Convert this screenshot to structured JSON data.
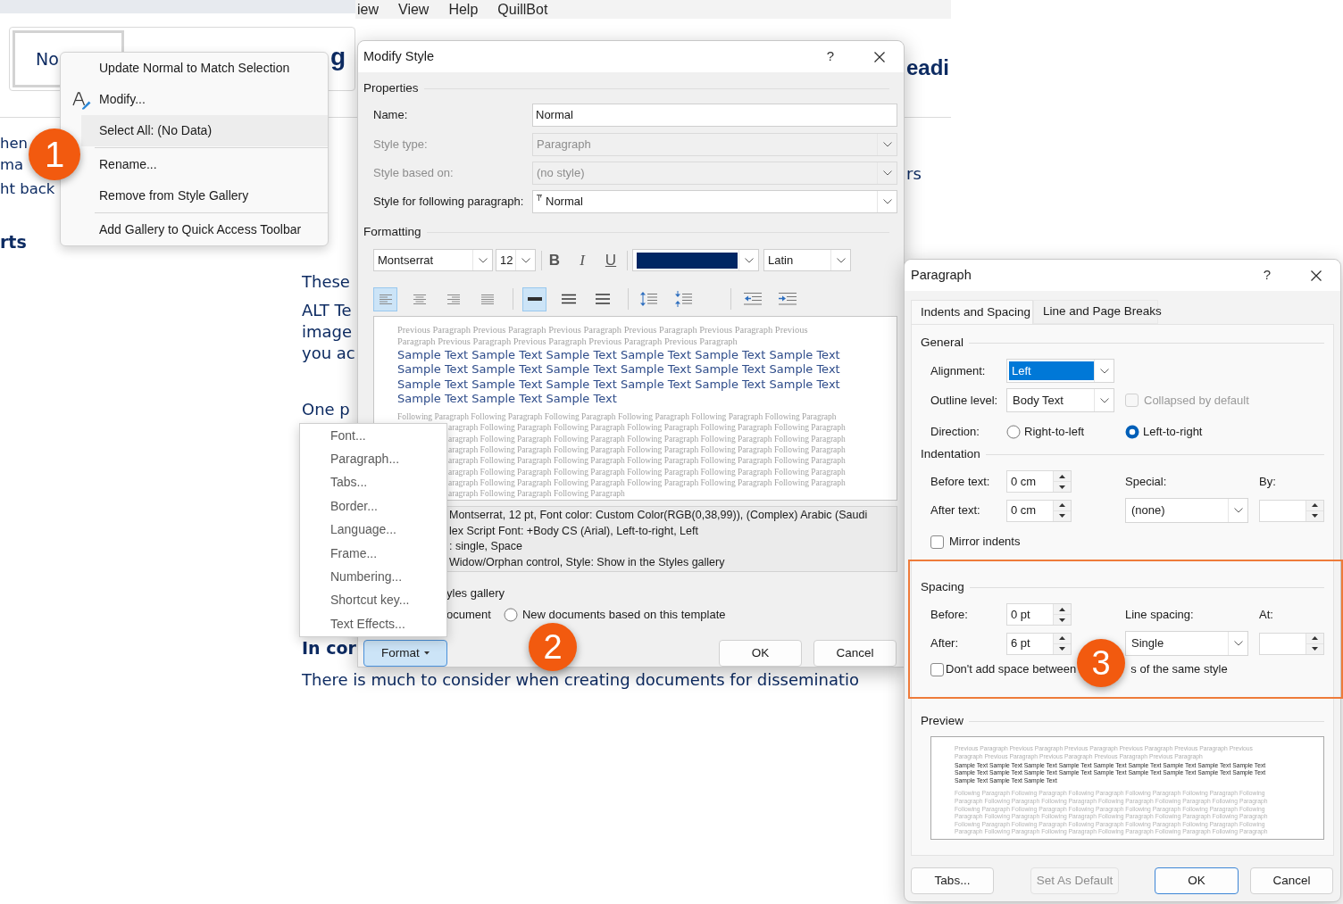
{
  "document": {
    "menu_bar": [
      "iew",
      "View",
      "Help",
      "QuillBot"
    ],
    "gallery_items": [
      {
        "text": "No",
        "kind": "normal",
        "selected": true
      },
      {
        "text": "g",
        "kind": "heading",
        "selected": false
      }
    ],
    "ribbon_right_item": "eadi",
    "left_lines": [
      {
        "text": "hen",
        "kind": "body"
      },
      {
        "text": "ma",
        "kind": "body"
      },
      {
        "text": "ht back",
        "kind": "body"
      },
      {
        "text": "rts",
        "kind": "heading"
      }
    ],
    "right_lines": [
      {
        "text": "rs",
        "kind": "body"
      }
    ],
    "center_lines": [
      {
        "text": "These",
        "kind": "body"
      },
      {
        "text": "ALT Te",
        "kind": "body"
      },
      {
        "text": "image",
        "kind": "body"
      },
      {
        "text": "you ac",
        "kind": "body"
      },
      {
        "text": "One p",
        "kind": "body"
      },
      {
        "text": "In cor",
        "kind": "heading"
      },
      {
        "text": "There is much to consider when creating documents for disseminatio",
        "kind": "body"
      }
    ]
  },
  "context_menu": {
    "items": [
      {
        "label": "Update Normal to Match Selection",
        "has_icon": false,
        "hovered": false,
        "separator_before": false
      },
      {
        "label": "Modify...",
        "has_icon": true,
        "hovered": false,
        "separator_before": false
      },
      {
        "label": "Select All: (No Data)",
        "has_icon": false,
        "hovered": true,
        "separator_before": false
      },
      {
        "label": "Rename...",
        "has_icon": false,
        "hovered": false,
        "separator_before": true
      },
      {
        "label": "Remove from Style Gallery",
        "has_icon": false,
        "hovered": false,
        "separator_before": false
      },
      {
        "label": "Add Gallery to Quick Access Toolbar",
        "has_icon": false,
        "hovered": false,
        "separator_before": true
      }
    ]
  },
  "modify_style": {
    "title": "Modify Style",
    "help": "?",
    "properties_heading": "Properties",
    "fields": [
      {
        "label": "Name:",
        "kind": "text",
        "value": "Normal",
        "disabled": false,
        "style_icon": false
      },
      {
        "label": "Style type:",
        "kind": "dropdown",
        "value": "Paragraph",
        "disabled": true,
        "style_icon": false
      },
      {
        "label": "Style based on:",
        "kind": "dropdown",
        "value": "(no style)",
        "disabled": true,
        "style_icon": false
      },
      {
        "label": "Style for following paragraph:",
        "kind": "dropdown",
        "value": "Normal",
        "disabled": false,
        "style_icon": true
      }
    ],
    "formatting_heading": "Formatting",
    "font": "Montserrat",
    "size": "12",
    "text_style_buttons": [
      {
        "label": "B",
        "kind": "bold"
      },
      {
        "label": "I",
        "kind": "italic"
      },
      {
        "label": "U",
        "kind": "underline"
      }
    ],
    "font_color": {
      "color": "#002663"
    },
    "script": "Latin",
    "alignment_buttons": [
      {
        "kind": "left",
        "selected": true
      },
      {
        "kind": "center",
        "selected": false
      },
      {
        "kind": "right",
        "selected": false
      },
      {
        "kind": "justify",
        "selected": false
      }
    ],
    "line_spacing_buttons": [
      {
        "kind": "single",
        "selected": true
      },
      {
        "kind": "one_half",
        "selected": false
      },
      {
        "kind": "double",
        "selected": false
      }
    ],
    "paragraph_spacing_buttons": [
      {
        "kind": "increase"
      },
      {
        "kind": "decrease"
      }
    ],
    "indent_buttons": [
      {
        "kind": "decrease"
      },
      {
        "kind": "increase"
      }
    ],
    "preview": {
      "previous": "Previous Paragraph Previous Paragraph Previous Paragraph Previous Paragraph Previous Paragraph Previous Paragraph Previous Paragraph Previous Paragraph Previous Paragraph Previous Paragraph",
      "sample": "Sample Text Sample Text Sample Text Sample Text Sample Text Sample Text Sample Text Sample Text Sample Text Sample Text Sample Text Sample Text Sample Text Sample Text Sample Text Sample Text Sample Text Sample Text Sample Text Sample Text Sample Text",
      "following": [
        "Following Paragraph Following Paragraph Following Paragraph Following Paragraph Following Paragraph Following Paragraph",
        "aragraph Following Paragraph Following Paragraph Following Paragraph Following Paragraph Following Paragraph",
        "aragraph Following Paragraph Following Paragraph Following Paragraph Following Paragraph Following Paragraph",
        "aragraph Following Paragraph Following Paragraph Following Paragraph Following Paragraph Following Paragraph",
        "aragraph Following Paragraph Following Paragraph Following Paragraph Following Paragraph Following Paragraph",
        "aragraph Following Paragraph Following Paragraph Following Paragraph Following Paragraph Following Paragraph",
        "aragraph Following Paragraph Following Paragraph Following Paragraph Following Paragraph Following Paragraph",
        "aragraph Following Paragraph Following Paragraph"
      ]
    },
    "description": [
      "Montserrat, 12 pt, Font color: Custom Color(RGB(0,38,99)), (Complex) Arabic (Saudi",
      "lex Script Font: +Body CS (Arial), Left-to-right, Left",
      ": single, Space",
      "Widow/Orphan control, Style: Show in the Styles gallery"
    ],
    "gallery_option": "yles gallery",
    "document_option": "ocument",
    "template_option": {
      "label": "New documents based on this template",
      "selected": false
    },
    "buttons": [
      {
        "label": "Format",
        "kind": "menu",
        "pressed": true
      },
      {
        "label": "OK",
        "kind": "plain",
        "pressed": false
      },
      {
        "label": "Cancel",
        "kind": "plain",
        "pressed": false
      }
    ]
  },
  "format_menu": {
    "items": [
      "Font...",
      "Paragraph...",
      "Tabs...",
      "Border...",
      "Language...",
      "Frame...",
      "Numbering...",
      "Shortcut key...",
      "Text Effects..."
    ]
  },
  "paragraph_dialog": {
    "title": "Paragraph",
    "help": "?",
    "tabs": [
      {
        "label": "Indents and Spacing",
        "selected": true
      },
      {
        "label": "Line and Page Breaks",
        "selected": false
      }
    ],
    "general": {
      "heading": "General",
      "alignment": {
        "label": "Alignment:",
        "value": "Left",
        "highlighted": true
      },
      "outline_level": {
        "label": "Outline level:",
        "value": "Body Text"
      },
      "collapsed": {
        "label": "Collapsed by default",
        "checked": false,
        "disabled": true
      },
      "direction": {
        "label": "Direction:",
        "options": [
          {
            "label": "Right-to-left",
            "selected": false
          },
          {
            "label": "Left-to-right",
            "selected": true
          }
        ]
      }
    },
    "indentation": {
      "heading": "Indentation",
      "before_text": {
        "label": "Before text:",
        "value": "0 cm"
      },
      "after_text": {
        "label": "After text:",
        "value": "0 cm"
      },
      "special": {
        "label": "Special:",
        "value": "(none)"
      },
      "by": {
        "label": "By:"
      },
      "mirror_indents": {
        "label": "Mirror indents",
        "checked": false
      }
    },
    "spacing": {
      "heading": "Spacing",
      "highlighted": true,
      "before": {
        "label": "Before:",
        "value": "0 pt"
      },
      "after": {
        "label": "After:",
        "value": "6 pt"
      },
      "line_spacing": {
        "label": "Line spacing:",
        "value": "Single"
      },
      "at": {
        "label": "At:"
      },
      "same_style": {
        "label_parts": [
          "Don't add space between",
          "s of the same style"
        ],
        "checked": false
      }
    },
    "preview": {
      "heading": "Preview",
      "previous": "Previous Paragraph Previous Paragraph Previous Paragraph Previous Paragraph Previous Paragraph Previous Paragraph Previous Paragraph Previous Paragraph Previous Paragraph Previous Paragraph",
      "sample": "Sample Text Sample Text Sample Text Sample Text Sample Text Sample Text Sample Text Sample Text Sample Text Sample Text Sample Text Sample Text Sample Text Sample Text Sample Text Sample Text Sample Text Sample Text Sample Text Sample Text Sample Text",
      "following": "Following Paragraph Following Paragraph Following Paragraph Following Paragraph Following Paragraph Following Paragraph Following Paragraph Following Paragraph Following Paragraph Following Paragraph Following Paragraph Following Paragraph Following Paragraph Following Paragraph Following Paragraph Following Paragraph Following Paragraph Following Paragraph Following Paragraph Following Paragraph Following Paragraph Following Paragraph Following Paragraph Following Paragraph Following Paragraph Following Paragraph Following Paragraph Following Paragraph Following Paragraph Following Paragraph Following Paragraph Following Paragraph Following Paragraph"
    },
    "buttons": [
      {
        "label": "Tabs...",
        "kind": "normal"
      },
      {
        "label": "Set As Default",
        "kind": "disabled"
      },
      {
        "label": "OK",
        "kind": "default"
      },
      {
        "label": "Cancel",
        "kind": "normal"
      }
    ]
  },
  "step_markers": [
    {
      "label": "1"
    },
    {
      "label": "2"
    },
    {
      "label": "3"
    }
  ]
}
